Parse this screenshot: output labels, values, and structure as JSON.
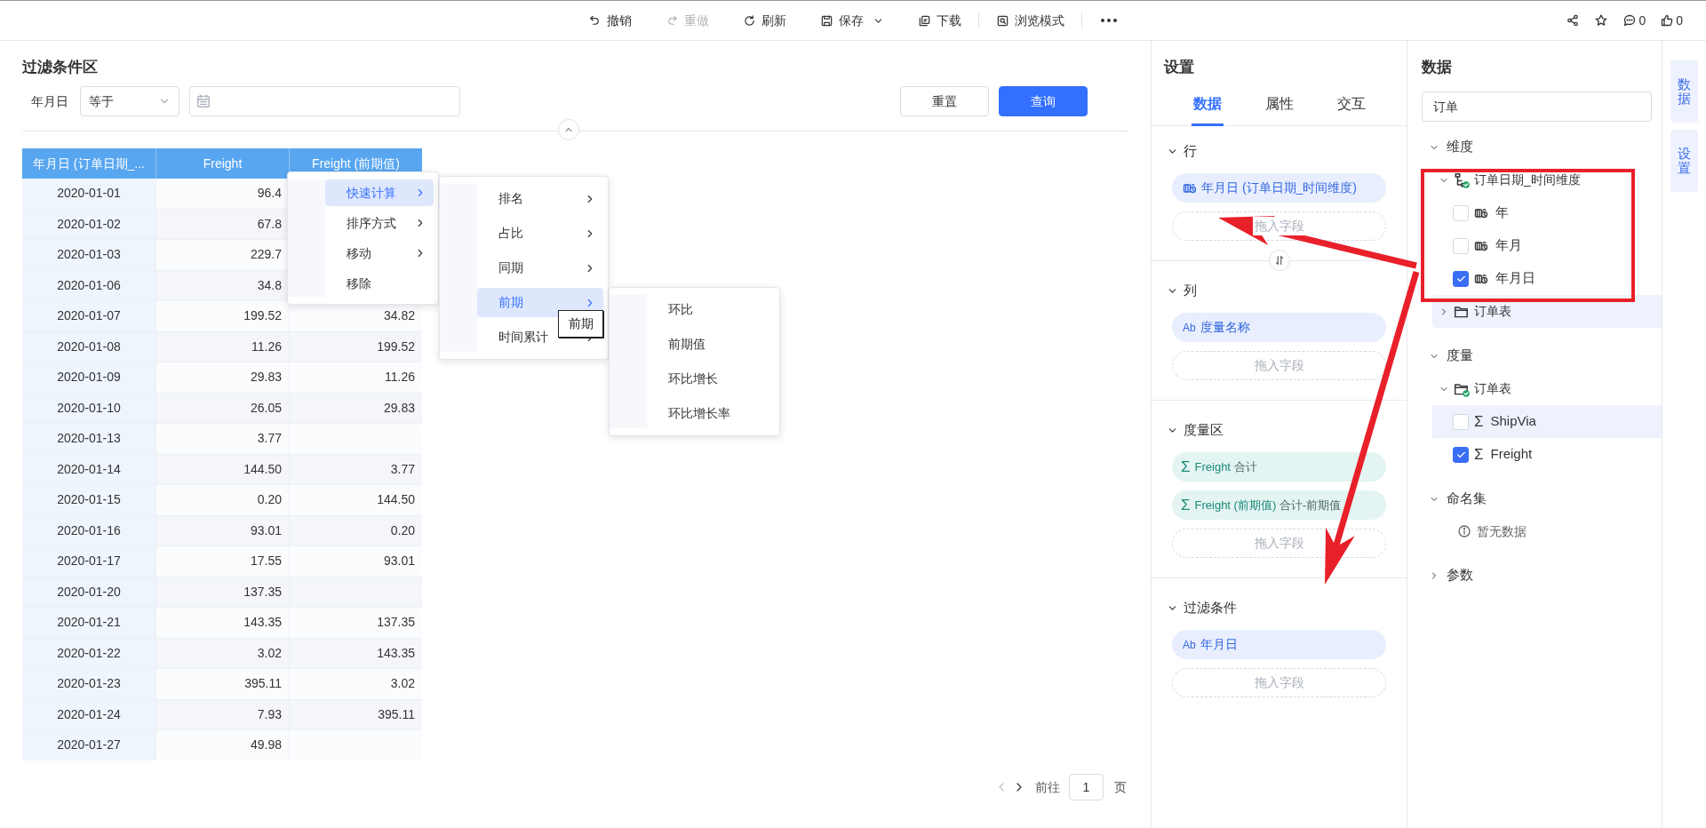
{
  "toolbar": {
    "actions": [
      {
        "kind": "undo",
        "label": "撤销",
        "disabled": false,
        "dropdown": false
      },
      {
        "kind": "redo",
        "label": "重做",
        "disabled": true,
        "dropdown": false
      },
      {
        "kind": "refresh",
        "label": "刷新",
        "disabled": false,
        "dropdown": false
      },
      {
        "kind": "save",
        "label": "保存",
        "disabled": false,
        "dropdown": true
      },
      {
        "kind": "download",
        "label": "下载",
        "disabled": false,
        "dropdown": false
      },
      {
        "kind": "browse",
        "label": "浏览模式",
        "disabled": false,
        "dropdown": false
      }
    ],
    "right": [
      {
        "kind": "share"
      },
      {
        "kind": "star"
      },
      {
        "kind": "comment",
        "count": "0"
      },
      {
        "kind": "like",
        "count": "0"
      }
    ]
  },
  "filter": {
    "title": "过滤条件区",
    "label": "年月日",
    "operator": "等于",
    "buttons": [
      {
        "label": "重置",
        "primary": false
      },
      {
        "label": "查询",
        "primary": true
      }
    ]
  },
  "table": {
    "columns": [
      "年月日 (订单日期_...",
      "Freight",
      "Freight (前期值)"
    ],
    "rows": [
      [
        "2020-01-01",
        "96.4"
      ],
      [
        "2020-01-02",
        "67.8"
      ],
      [
        "2020-01-03",
        "229.7"
      ],
      [
        "2020-01-06",
        "34.8"
      ],
      [
        "2020-01-07",
        "199.52",
        "34.82"
      ],
      [
        "2020-01-08",
        "11.26",
        "199.52"
      ],
      [
        "2020-01-09",
        "29.83",
        "11.26"
      ],
      [
        "2020-01-10",
        "26.05",
        "29.83"
      ],
      [
        "2020-01-13",
        "3.77",
        null
      ],
      [
        "2020-01-14",
        "144.50",
        "3.77"
      ],
      [
        "2020-01-15",
        "0.20",
        "144.50"
      ],
      [
        "2020-01-16",
        "93.01",
        "0.20"
      ],
      [
        "2020-01-17",
        "17.55",
        "93.01"
      ],
      [
        "2020-01-20",
        "137.35",
        null
      ],
      [
        "2020-01-21",
        "143.35",
        "137.35"
      ],
      [
        "2020-01-22",
        "3.02",
        "143.35"
      ],
      [
        "2020-01-23",
        "395.11",
        "3.02"
      ],
      [
        "2020-01-24",
        "7.93",
        "395.11"
      ],
      [
        "2020-01-27",
        "49.98",
        null
      ]
    ]
  },
  "context_menu": {
    "items": [
      {
        "label": "快速计算",
        "selected": true,
        "submenu": true
      },
      {
        "label": "排序方式",
        "selected": false,
        "submenu": true
      },
      {
        "label": "移动",
        "selected": false,
        "submenu": true
      },
      {
        "label": "移除",
        "selected": false,
        "submenu": false
      }
    ]
  },
  "submenu": {
    "items": [
      {
        "label": "排名",
        "selected": false,
        "submenu": true
      },
      {
        "label": "占比",
        "selected": false,
        "submenu": true
      },
      {
        "label": "同期",
        "selected": false,
        "submenu": true
      },
      {
        "label": "前期",
        "selected": true,
        "submenu": true
      },
      {
        "label": "时间累计",
        "selected": false,
        "submenu": true
      }
    ]
  },
  "tooltip": "前期",
  "submenu_2": {
    "items": [
      {
        "label": "环比",
        "selected": false,
        "submenu": false
      },
      {
        "label": "前期值",
        "selected": false,
        "submenu": false
      },
      {
        "label": "环比增长",
        "selected": false,
        "submenu": false
      },
      {
        "label": "环比增长率",
        "selected": false,
        "submenu": false
      }
    ]
  },
  "pagination": {
    "prev_disabled": true,
    "next_disabled": false,
    "label": "前往",
    "page": "1",
    "suffix": "页"
  },
  "settings": {
    "title": "设置",
    "tabs": [
      {
        "label": "数据",
        "selected": true
      },
      {
        "label": "属性",
        "selected": false
      },
      {
        "label": "交互",
        "selected": false
      }
    ],
    "sections": [
      {
        "title": "行",
        "expanded": true,
        "fields": [
          {
            "kind": "date",
            "label": "年月日 (订单日期_时间维度)"
          }
        ],
        "drop_hint": "拖入字段"
      },
      {
        "title": "列",
        "expanded": true,
        "fields": [
          {
            "kind": "text",
            "mark": "Ab",
            "label": "度量名称"
          }
        ],
        "drop_hint": "拖入字段"
      },
      {
        "title": "度量区",
        "expanded": true,
        "fields": [
          {
            "kind": "measure",
            "mark": "Σ",
            "label": "Freight",
            "aggregate": "合计"
          },
          {
            "kind": "measure",
            "mark": "Σ",
            "label": "Freight (前期值)",
            "aggregate": "合计-前期值"
          }
        ],
        "drop_hint": "拖入字段"
      },
      {
        "title": "过滤条件",
        "expanded": true,
        "fields": [
          {
            "kind": "text",
            "mark": "Ab",
            "label": "年月日"
          }
        ],
        "drop_hint": "拖入字段"
      }
    ]
  },
  "data": {
    "title": "数据",
    "search": "订单",
    "groups": [
      {
        "label": "维度",
        "expanded": true,
        "children": [
          {
            "kind": "hierarchy",
            "label": "订单日期_时间维度",
            "expanded": true,
            "hovered": false,
            "children": [
              {
                "kind": "date",
                "label": "年",
                "checked": false,
                "hovered": false
              },
              {
                "kind": "date",
                "label": "年月",
                "checked": false,
                "hovered": false
              },
              {
                "kind": "date",
                "label": "年月日",
                "checked": true,
                "hovered": false
              }
            ]
          },
          {
            "kind": "folder",
            "label": "订单表",
            "expanded": false,
            "hovered": true
          }
        ]
      },
      {
        "label": "度量",
        "expanded": true,
        "children": [
          {
            "kind": "folder_checked",
            "label": "订单表",
            "expanded": true,
            "hovered": false,
            "children": [
              {
                "kind": "measure",
                "mark": "Σ",
                "label": "ShipVia",
                "checked": false,
                "hovered": true
              },
              {
                "kind": "measure",
                "mark": "Σ",
                "label": "Freight",
                "checked": true,
                "hovered": false
              }
            ]
          }
        ]
      },
      {
        "label": "命名集",
        "expanded": true,
        "empty": "暂无数据"
      },
      {
        "label": "参数",
        "expanded": false
      }
    ]
  },
  "side_tabs": [
    {
      "label": "数据"
    },
    {
      "label": "设置"
    }
  ]
}
